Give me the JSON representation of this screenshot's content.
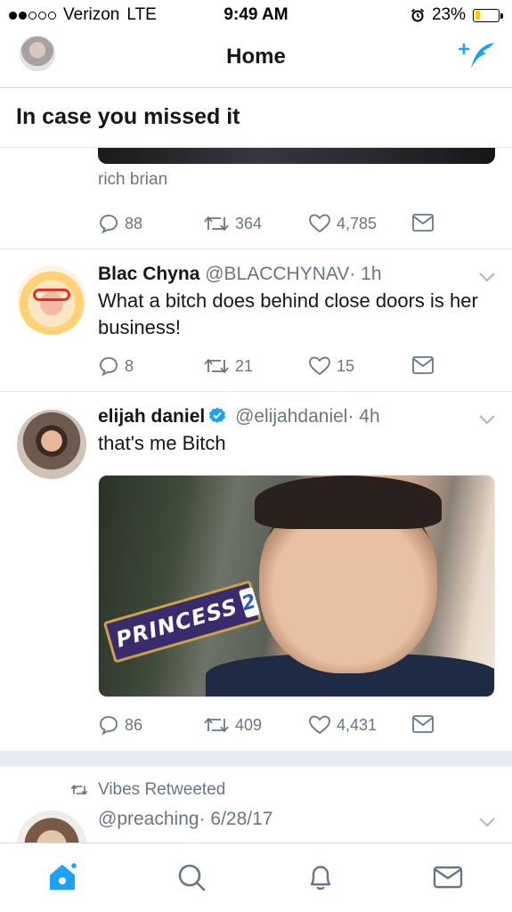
{
  "status_bar": {
    "carrier": "Verizon",
    "network": "LTE",
    "time": "9:49 AM",
    "battery": "23%",
    "battery_level": 0.23,
    "signal_bars": 2
  },
  "header": {
    "title": "Home"
  },
  "section": {
    "title": "In case you missed it"
  },
  "tweets": [
    {
      "caption": "rich brian",
      "replies": "88",
      "retweets": "364",
      "likes": "4,785"
    },
    {
      "name": "Blac Chyna",
      "handle": "@BLACCHYNAV",
      "time": "· 1h",
      "text": "What a bitch does behind close doors is her business!",
      "replies": "8",
      "retweets": "21",
      "likes": "15"
    },
    {
      "name": "elijah daniel",
      "verified": true,
      "handle": "@elijahdaniel",
      "time": "· 4h",
      "text": "that's me Bitch",
      "media_text": "PRINCESS",
      "media_number": "2",
      "replies": "86",
      "retweets": "409",
      "likes": "4,431"
    },
    {
      "retweeted_by": "Vibes Retweeted",
      "handle": "@preaching",
      "time": "· 6/28/17"
    }
  ],
  "tab_bar": {
    "icons": [
      "home-icon",
      "search-icon",
      "notifications-icon",
      "messages-icon"
    ],
    "active": "home-icon"
  },
  "colors": {
    "accent": "#1da1f2",
    "secondary_text": "#657786",
    "battery": "#ffcc00"
  }
}
